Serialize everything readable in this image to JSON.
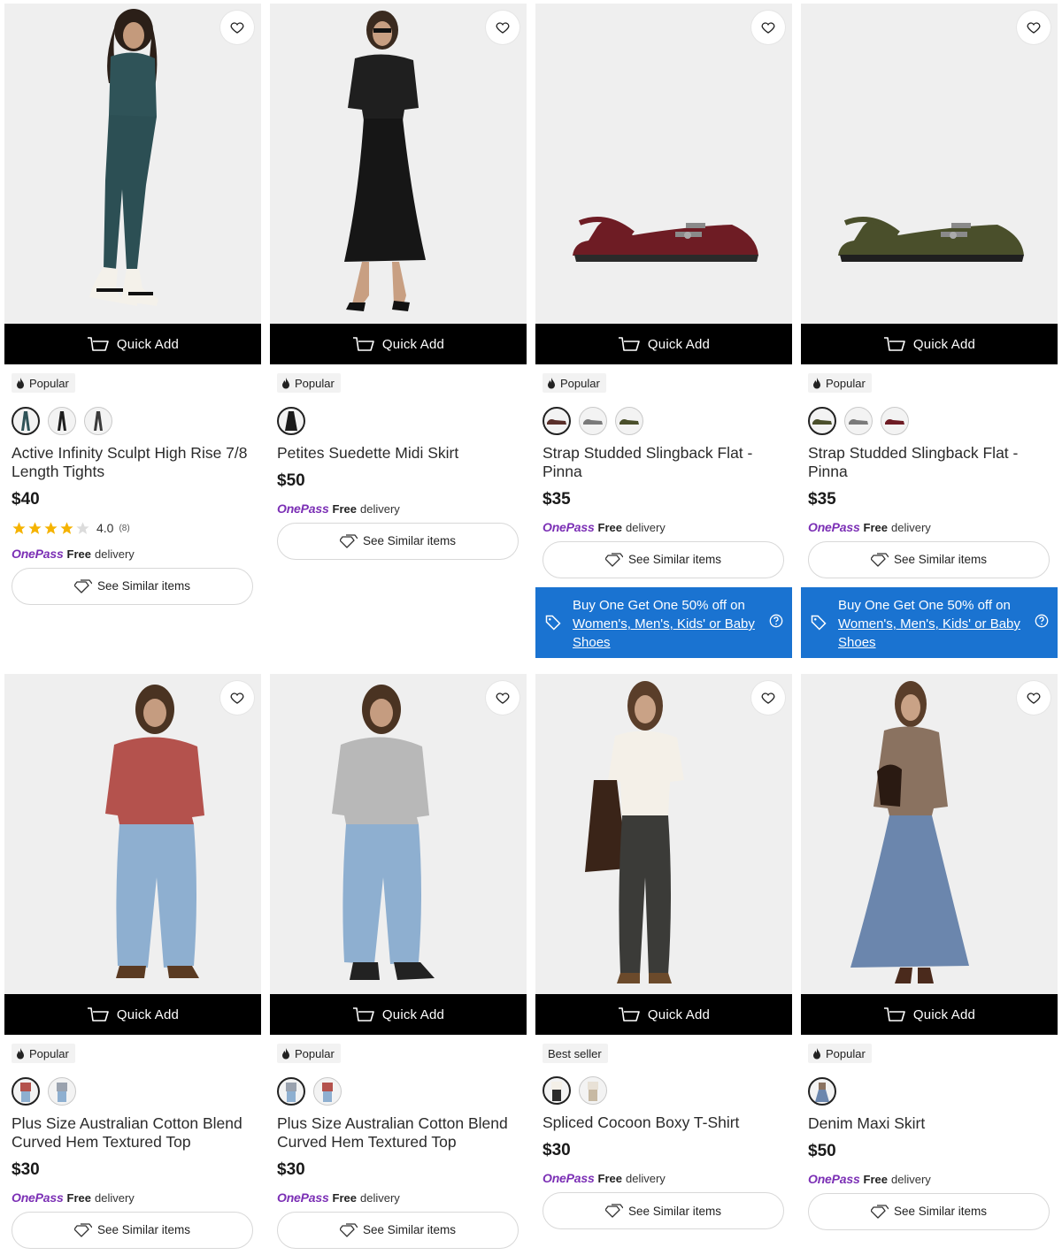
{
  "quick_add_label": "Quick Add",
  "similar_label": "See Similar items",
  "onepass": {
    "brand": "OnePass",
    "free": "Free",
    "delivery": "delivery"
  },
  "promo": {
    "text": "Buy One Get One 50% off on",
    "link": "Women's, Men's, Kids' or Baby Shoes"
  },
  "products": [
    {
      "badge": "Popular",
      "title": "Active Infinity Sculpt High Rise 7/8 Length Tights",
      "price": "$40",
      "rating": "4.0",
      "rating_count": "(8)",
      "stars": 4,
      "swatch_count": 3,
      "colors": [
        "#2f5358",
        "#1e1e1e",
        "#3a3a3a"
      ]
    },
    {
      "badge": "Popular",
      "title": "Petites Suedette Midi Skirt",
      "price": "$50",
      "swatch_count": 1,
      "colors": [
        "#1a1a1a"
      ]
    },
    {
      "badge": "Popular",
      "title": "Strap Studded Slingback Flat - Pinna",
      "price": "$35",
      "swatch_count": 3,
      "colors": [
        "#5a2f2a",
        "#7a7a7a",
        "#4a4f2b"
      ],
      "promo": true
    },
    {
      "badge": "Popular",
      "title": "Strap Studded Slingback Flat - Pinna",
      "price": "$35",
      "swatch_count": 3,
      "colors": [
        "#4a4f2b",
        "#7a7a7a",
        "#6e1c24"
      ],
      "promo": true
    },
    {
      "badge": "Popular",
      "title": "Plus Size Australian Cotton Blend Curved Hem Textured Top",
      "price": "$30",
      "swatch_count": 2,
      "colors": [
        "#b4524d",
        "#9aa2ae"
      ]
    },
    {
      "badge": "Popular",
      "title": "Plus Size Australian Cotton Blend Curved Hem Textured Top",
      "price": "$30",
      "swatch_count": 2,
      "colors": [
        "#9aa2ae",
        "#b4524d"
      ]
    },
    {
      "badge": "Best seller",
      "title": "Spliced Cocoon Boxy T-Shirt",
      "price": "$30",
      "swatch_count": 2,
      "colors": [
        "#2c2c2c",
        "#e8e1d6"
      ]
    },
    {
      "badge": "Popular",
      "title": "Denim Maxi Skirt",
      "price": "$50",
      "swatch_count": 1,
      "colors": [
        "#6b7fa0"
      ]
    }
  ],
  "colors": {
    "quick_add_bg": "#000000",
    "promo_bg": "#1a73d1",
    "onepass": "#7b2fb5",
    "star": "#f5b301"
  }
}
